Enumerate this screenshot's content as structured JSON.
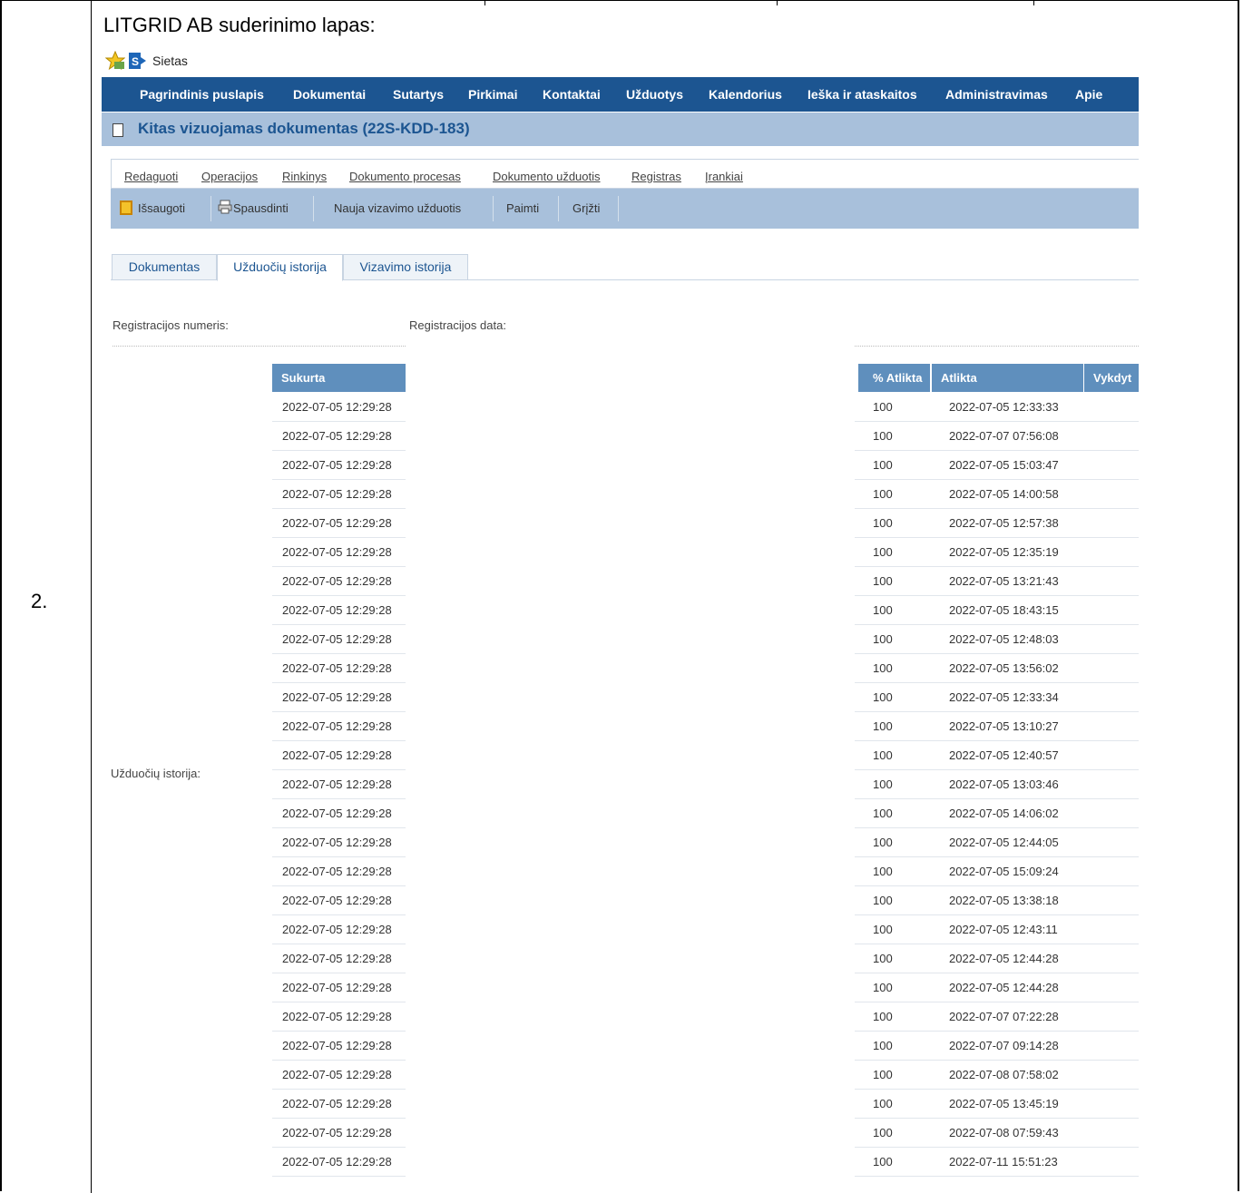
{
  "row_number": "2.",
  "caption": "LITGRID AB suderinimo lapas:",
  "sharepoint": {
    "site_name": "Sietas",
    "logo_text": "S"
  },
  "topnav": [
    "Pagrindinis puslapis",
    "Dokumentai",
    "Sutartys",
    "Pirkimai",
    "Kontaktai",
    "Užduotys",
    "Kalendorius",
    "Ieška ir ataskaitos",
    "Administravimas",
    "Apie"
  ],
  "page_title": "Kitas vizuojamas dokumentas (22S-KDD-183)",
  "menu": [
    "Redaguoti",
    "Operacijos",
    "Rinkinys",
    "Dokumento procesas",
    "Dokumento užduotis",
    "Registras",
    "Įrankiai"
  ],
  "toolbar": {
    "save": "Išsaugoti",
    "print": "Spausdinti",
    "new_task": "Nauja vizavimo užduotis",
    "take": "Paimti",
    "back": "Grįžti"
  },
  "tabs": [
    "Dokumentas",
    "Užduočių istorija",
    "Vizavimo istorija"
  ],
  "fields": {
    "reg_number_label": "Registracijos numeris:",
    "reg_date_label": "Registracijos data:",
    "task_history_label": "Užduočių istorija:"
  },
  "table": {
    "headers": {
      "created": "Sukurta",
      "percent": "% Atlikta",
      "done": "Atlikta",
      "executor": "Vykdyt"
    },
    "rows": [
      {
        "created": "2022-07-05 12:29:28",
        "percent": "100",
        "done": "2022-07-05 12:33:33"
      },
      {
        "created": "2022-07-05 12:29:28",
        "percent": "100",
        "done": "2022-07-07 07:56:08"
      },
      {
        "created": "2022-07-05 12:29:28",
        "percent": "100",
        "done": "2022-07-05 15:03:47"
      },
      {
        "created": "2022-07-05 12:29:28",
        "percent": "100",
        "done": "2022-07-05 14:00:58"
      },
      {
        "created": "2022-07-05 12:29:28",
        "percent": "100",
        "done": "2022-07-05 12:57:38"
      },
      {
        "created": "2022-07-05 12:29:28",
        "percent": "100",
        "done": "2022-07-05 12:35:19"
      },
      {
        "created": "2022-07-05 12:29:28",
        "percent": "100",
        "done": "2022-07-05 13:21:43"
      },
      {
        "created": "2022-07-05 12:29:28",
        "percent": "100",
        "done": "2022-07-05 18:43:15"
      },
      {
        "created": "2022-07-05 12:29:28",
        "percent": "100",
        "done": "2022-07-05 12:48:03"
      },
      {
        "created": "2022-07-05 12:29:28",
        "percent": "100",
        "done": "2022-07-05 13:56:02"
      },
      {
        "created": "2022-07-05 12:29:28",
        "percent": "100",
        "done": "2022-07-05 12:33:34"
      },
      {
        "created": "2022-07-05 12:29:28",
        "percent": "100",
        "done": "2022-07-05 13:10:27"
      },
      {
        "created": "2022-07-05 12:29:28",
        "percent": "100",
        "done": "2022-07-05 12:40:57"
      },
      {
        "created": "2022-07-05 12:29:28",
        "percent": "100",
        "done": "2022-07-05 13:03:46"
      },
      {
        "created": "2022-07-05 12:29:28",
        "percent": "100",
        "done": "2022-07-05 14:06:02"
      },
      {
        "created": "2022-07-05 12:29:28",
        "percent": "100",
        "done": "2022-07-05 12:44:05"
      },
      {
        "created": "2022-07-05 12:29:28",
        "percent": "100",
        "done": "2022-07-05 15:09:24"
      },
      {
        "created": "2022-07-05 12:29:28",
        "percent": "100",
        "done": "2022-07-05 13:38:18"
      },
      {
        "created": "2022-07-05 12:29:28",
        "percent": "100",
        "done": "2022-07-05 12:43:11"
      },
      {
        "created": "2022-07-05 12:29:28",
        "percent": "100",
        "done": "2022-07-05 12:44:28"
      },
      {
        "created": "2022-07-05 12:29:28",
        "percent": "100",
        "done": "2022-07-05 12:44:28"
      },
      {
        "created": "2022-07-05 12:29:28",
        "percent": "100",
        "done": "2022-07-07 07:22:28"
      },
      {
        "created": "2022-07-05 12:29:28",
        "percent": "100",
        "done": "2022-07-07 09:14:28"
      },
      {
        "created": "2022-07-05 12:29:28",
        "percent": "100",
        "done": "2022-07-08 07:58:02"
      },
      {
        "created": "2022-07-05 12:29:28",
        "percent": "100",
        "done": "2022-07-05 13:45:19"
      },
      {
        "created": "2022-07-05 12:29:28",
        "percent": "100",
        "done": "2022-07-08 07:59:43"
      },
      {
        "created": "2022-07-05 12:29:28",
        "percent": "100",
        "done": "2022-07-11 15:51:23"
      }
    ]
  },
  "colors": {
    "nav_blue": "#1c5591",
    "title_band": "#a8c0db",
    "table_header": "#5f8fbd"
  },
  "icons": [
    "star-icon",
    "sharepoint-logo-icon",
    "document-icon",
    "save-icon",
    "printer-icon"
  ]
}
